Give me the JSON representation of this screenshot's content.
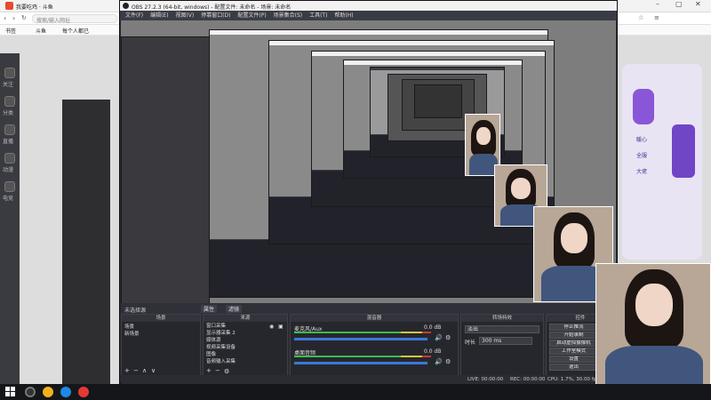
{
  "browser": {
    "tab_title": "我要吃鸡 · 斗鱼",
    "address_hint": "搜索/输入网址",
    "bookmarks": [
      "书签",
      "斗鱼",
      "每个人都已"
    ],
    "sidebar": [
      "关注",
      "分类",
      "直播",
      "动漫",
      "电竞"
    ],
    "right_badges": [
      "暖心",
      "全服",
      "大佬"
    ]
  },
  "obs": {
    "title": "OBS 27.2.3 (64-bit, windows) - 配置文件: 未命名 - 场景: 未命名",
    "menu": [
      "文件(F)",
      "编辑(E)",
      "视图(V)",
      "停靠窗口(D)",
      "配置文件(P)",
      "场景集合(S)",
      "工具(T)",
      "帮助(H)"
    ],
    "scene_status": "未选择源",
    "scene_props": "属性",
    "scene_filter": "滤镜",
    "docks": {
      "scenes": {
        "header": "场景",
        "items": [
          "场景",
          "新场景"
        ]
      },
      "sources": {
        "header": "来源",
        "items": [
          "窗口采集",
          "显示器采集 2",
          "媒体源",
          "视频采集设备",
          "图像",
          "音频输入采集"
        ]
      },
      "mixer": {
        "header": "混音器",
        "channels": [
          {
            "name": "麦克风/Aux",
            "db": "0.0 dB"
          },
          {
            "name": "桌面音频",
            "db": "0.0 dB"
          }
        ]
      },
      "transitions": {
        "header": "转场特效",
        "type": "淡出",
        "duration_label": "时长",
        "duration": "300 ms"
      },
      "controls": {
        "header": "控件",
        "buttons": [
          "停止推流",
          "开始录制",
          "启动虚拟摄像机",
          "工作室模式",
          "设置",
          "退出"
        ]
      }
    },
    "status": {
      "live": "LIVE: 00:00:00",
      "rec": "REC: 00:00:00",
      "cpu": "CPU: 1.7%, 30.00 fps"
    },
    "footer_icons": [
      "+",
      "−",
      "∧",
      "∨"
    ]
  },
  "colors": {
    "obs_bg": "#2b2c33",
    "meter_green": "#3bbf4a",
    "meter_yellow": "#d8c53a",
    "meter_red": "#c83a3a",
    "volume_blue": "#3a78d8"
  }
}
